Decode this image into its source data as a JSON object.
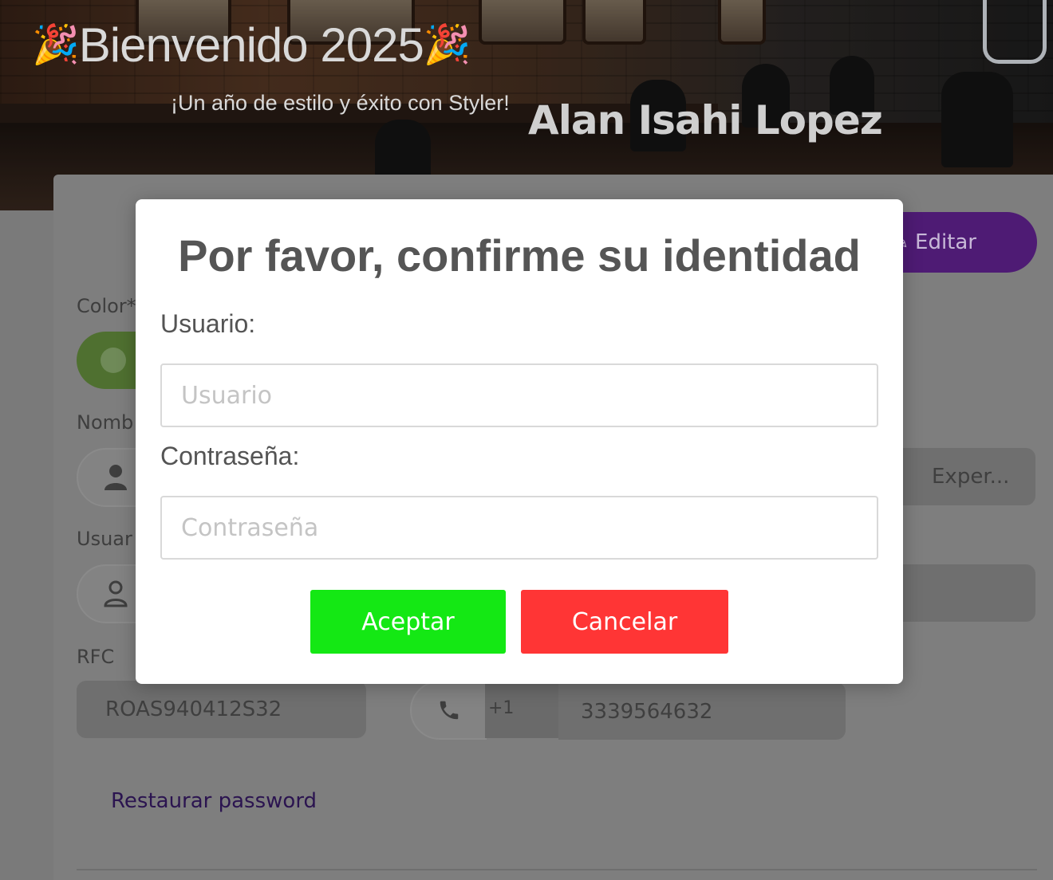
{
  "header": {
    "welcome_emoji": "🎉",
    "welcome_title": "Bienvenido 2025",
    "tagline": "¡Un año de estilo y éxito con Styler!",
    "user_name": "Alan Isahi Lopez"
  },
  "profile": {
    "edit_label": "Editar",
    "color_label": "Color*",
    "name_label": "Nomb",
    "user_label": "Usuar",
    "rfc_label": "RFC",
    "rfc_value": "ROAS940412S32",
    "experience_value": "Exper...",
    "phone_code": "+1",
    "phone_number": "3339564632",
    "restore_password": "Restaurar password"
  },
  "modal": {
    "title": "Por favor, confirme su identidad",
    "user_label": "Usuario:",
    "user_placeholder": "Usuario",
    "password_label": "Contraseña:",
    "password_placeholder": "Contraseña",
    "accept_label": "Aceptar",
    "cancel_label": "Cancelar"
  },
  "colors": {
    "accept": "#14e814",
    "cancel": "#ff3535",
    "edit_button": "#6a2bb0",
    "link": "#3d1f7a"
  }
}
